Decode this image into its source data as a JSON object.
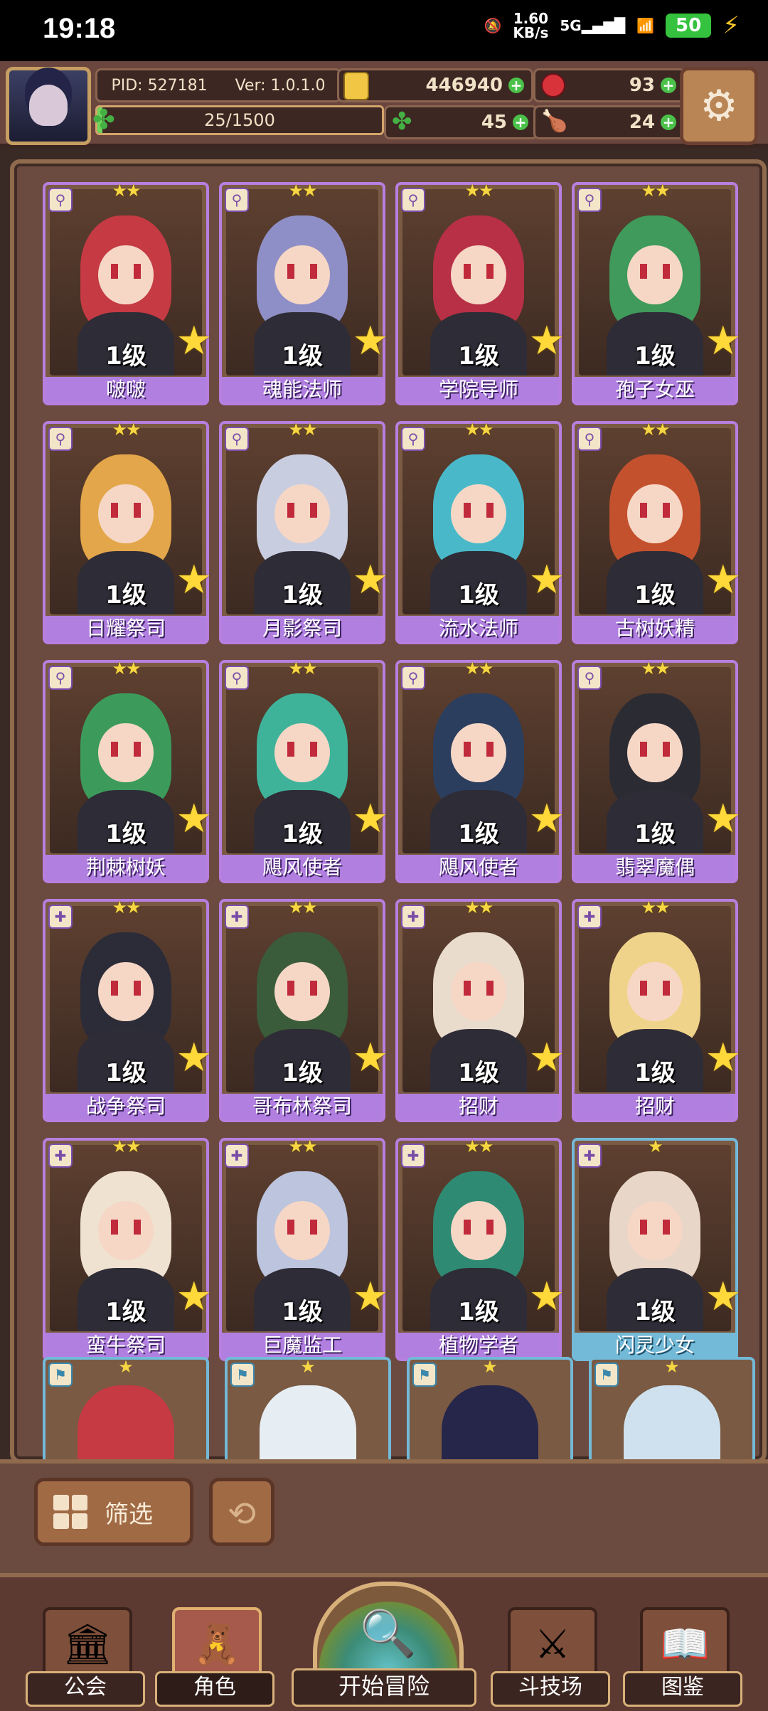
{
  "status_bar": {
    "time": "19:18",
    "net_speed_value": "1.60",
    "net_speed_unit": "KB/s",
    "network": "5G",
    "battery": "50"
  },
  "header": {
    "pid": "PID: 527181",
    "version": "Ver: 1.0.1.0",
    "exp_text": "25/1500",
    "exp_progress": 0.0167,
    "gold": "446940",
    "gems": "93",
    "clover": "45",
    "food": "24"
  },
  "cards": [
    {
      "level": "1级",
      "name": "啵啵",
      "stars": "★★",
      "hair": "#c53a43",
      "frame": "purple"
    },
    {
      "level": "1级",
      "name": "魂能法师",
      "stars": "★★",
      "hair": "#8f8fc7",
      "frame": "purple"
    },
    {
      "level": "1级",
      "name": "学院导师",
      "stars": "★★",
      "hair": "#b83045",
      "frame": "purple"
    },
    {
      "level": "1级",
      "name": "孢子女巫",
      "stars": "★★",
      "hair": "#3f9a5b",
      "frame": "purple"
    },
    {
      "level": "1级",
      "name": "日耀祭司",
      "stars": "★★",
      "hair": "#e3a64a",
      "frame": "purple"
    },
    {
      "level": "1级",
      "name": "月影祭司",
      "stars": "★★",
      "hair": "#c9cde0",
      "frame": "purple"
    },
    {
      "level": "1级",
      "name": "流水法师",
      "stars": "★★",
      "hair": "#49b9c9",
      "frame": "purple"
    },
    {
      "level": "1级",
      "name": "古树妖精",
      "stars": "★★",
      "hair": "#c4512e",
      "frame": "purple"
    },
    {
      "level": "1级",
      "name": "荆棘树妖",
      "stars": "★★",
      "hair": "#3c9b5b",
      "frame": "purple"
    },
    {
      "level": "1级",
      "name": "飓风使者",
      "stars": "★★",
      "hair": "#3fb39a",
      "frame": "purple"
    },
    {
      "level": "1级",
      "name": "飓风使者",
      "stars": "★★",
      "hair": "#2b3e5e",
      "frame": "purple"
    },
    {
      "level": "1级",
      "name": "翡翠魔偶",
      "stars": "★★",
      "hair": "#2b2b33",
      "frame": "purple"
    },
    {
      "level": "1级",
      "name": "战争祭司",
      "stars": "★★",
      "hair": "#2c2c38",
      "frame": "purple"
    },
    {
      "level": "1级",
      "name": "哥布林祭司",
      "stars": "★★",
      "hair": "#3a5c3a",
      "frame": "purple"
    },
    {
      "level": "1级",
      "name": "招财",
      "stars": "★★",
      "hair": "#e9dccd",
      "frame": "purple"
    },
    {
      "level": "1级",
      "name": "招财",
      "stars": "★★",
      "hair": "#f0d38a",
      "frame": "purple"
    },
    {
      "level": "1级",
      "name": "蛮牛祭司",
      "stars": "★★",
      "hair": "#efe2d0",
      "frame": "purple"
    },
    {
      "level": "1级",
      "name": "巨魔监工",
      "stars": "★★",
      "hair": "#bcc4de",
      "frame": "purple"
    },
    {
      "level": "1级",
      "name": "植物学者",
      "stars": "★★",
      "hair": "#2f8a73",
      "frame": "purple"
    },
    {
      "level": "1级",
      "name": "闪灵少女",
      "stars": "★",
      "hair": "#e8d6c8",
      "frame": "blue"
    }
  ],
  "partial_cards": [
    {
      "stars": "★",
      "hair": "#c53a43"
    },
    {
      "stars": "★",
      "hair": "#e6eef4"
    },
    {
      "stars": "★",
      "hair": "#25264a"
    },
    {
      "stars": "★",
      "hair": "#cfe1ee"
    }
  ],
  "controls": {
    "filter_label": "筛选"
  },
  "nav": {
    "guild": "公会",
    "characters": "角色",
    "adventure": "开始冒险",
    "arena": "斗技场",
    "codex": "图鉴"
  }
}
